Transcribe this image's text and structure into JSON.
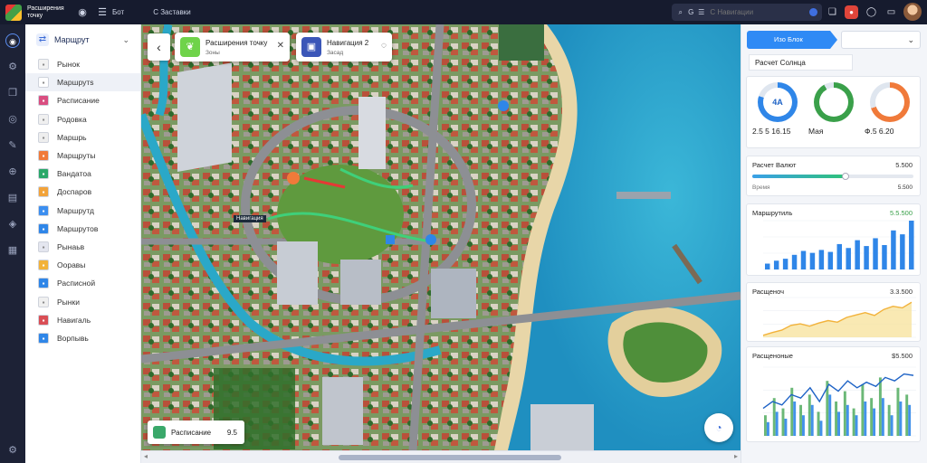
{
  "topbar": {
    "brand": "Расширения точку",
    "icon1": "◉",
    "icon2": "☰",
    "nav1": "Бот",
    "nav2": "С Заставки",
    "search_placeholder": "С Навигации",
    "search_icon1": "⌕",
    "search_icon2": "G",
    "search_icon3": "☰"
  },
  "rail": [
    "◉",
    "⚙",
    "❒",
    "◎",
    "✎",
    "⊕",
    "▤",
    "◈",
    "▦"
  ],
  "sidebar": {
    "header": "Марщрут",
    "items": [
      {
        "label": "Рынок",
        "color": "#f2f2f2",
        "fg": "#888"
      },
      {
        "label": "Маршрутs",
        "color": "#ffffff",
        "fg": "#888"
      },
      {
        "label": "Расписание",
        "color": "#d94e80",
        "fg": "#fff"
      },
      {
        "label": "Родовка",
        "color": "#f0f0f0",
        "fg": "#888"
      },
      {
        "label": "Маршрь",
        "color": "#eeeeee",
        "fg": "#888"
      },
      {
        "label": "Марщруты",
        "color": "#f07a3a",
        "fg": "#fff"
      },
      {
        "label": "Вандатоа",
        "color": "#2aa86a",
        "fg": "#fff"
      },
      {
        "label": "Доспаров",
        "color": "#f2a33a",
        "fg": "#fff"
      },
      {
        "label": "Маршрутд",
        "color": "#3b8ef0",
        "fg": "#fff"
      },
      {
        "label": "Маршрутов",
        "color": "#2f86e8",
        "fg": "#fff"
      },
      {
        "label": "Рынаьв",
        "color": "#e4e6ef",
        "fg": "#888"
      },
      {
        "label": "Ооравы",
        "color": "#f2b23a",
        "fg": "#fff"
      },
      {
        "label": "Расписной",
        "color": "#2f86e8",
        "fg": "#fff"
      },
      {
        "label": "Рынки",
        "color": "#f0f0f0",
        "fg": "#888"
      },
      {
        "label": "Навигаль",
        "color": "#d94e55",
        "fg": "#fff"
      },
      {
        "label": "Ворпывь",
        "color": "#2f86e8",
        "fg": "#fff"
      }
    ]
  },
  "map": {
    "card1": {
      "title": "Расширения точку",
      "sub": "Зоны"
    },
    "card2": {
      "title": "Навигация 2",
      "sub": "Засад"
    },
    "badge": "Навигация",
    "bottom_card": {
      "label": "Расписание",
      "value": "9.5"
    }
  },
  "right_panel": {
    "tab": "Изо Блок",
    "select_icon": "⌄",
    "label": "Расчет Солнца",
    "donuts": [
      {
        "center": "4А",
        "value": "2.5 5 16.15",
        "color": "#2f86e8",
        "pct": 0.8
      },
      {
        "center": "",
        "value": "Мая",
        "color": "#3aa04a",
        "pct": 0.92
      },
      {
        "center": "",
        "value": "Ф.5 6.20",
        "color": "#f07a3a",
        "pct": 0.7
      }
    ],
    "progress_panel": {
      "title": "Расчет Валют",
      "value": "5.500",
      "sub": "Время",
      "sub_value": "5.500",
      "fill": 0.58
    },
    "bar_panel": {
      "title": "Маршрутиль",
      "value": "5.5.500"
    },
    "area_panel": {
      "title": "Расщеноч",
      "value": "3.3.500"
    },
    "combo_panel": {
      "title": "Расщеноные",
      "value": "$5.500"
    }
  },
  "chart_data": [
    {
      "type": "bar",
      "title": "Маршрутиль",
      "values": [
        12,
        18,
        22,
        30,
        38,
        34,
        40,
        36,
        52,
        44,
        60,
        48,
        64,
        50,
        80,
        72,
        100
      ],
      "color": "#2f86e8",
      "ylim": [
        0,
        100
      ]
    },
    {
      "type": "area",
      "title": "Расщеноч",
      "values": [
        5,
        12,
        18,
        30,
        34,
        28,
        36,
        42,
        38,
        50,
        56,
        62,
        55,
        70,
        78,
        74,
        88
      ],
      "color": "#f2b23a",
      "ylim": [
        0,
        100
      ]
    },
    {
      "type": "bar",
      "title": "Расщеноные",
      "series": [
        {
          "name": "",
          "values": [
            30,
            55,
            40,
            70,
            45,
            60,
            35,
            80,
            50,
            65,
            40,
            75,
            55,
            85,
            45,
            70,
            60
          ],
          "color": "#3aa04a"
        },
        {
          "name": "",
          "values": [
            20,
            35,
            25,
            50,
            30,
            45,
            22,
            60,
            35,
            45,
            30,
            50,
            40,
            55,
            30,
            50,
            45
          ],
          "color": "#2f86e8"
        }
      ],
      "line": [
        40,
        50,
        45,
        60,
        55,
        70,
        50,
        75,
        65,
        80,
        70,
        78,
        72,
        85,
        80,
        90,
        88
      ],
      "ylim": [
        0,
        100
      ]
    }
  ]
}
